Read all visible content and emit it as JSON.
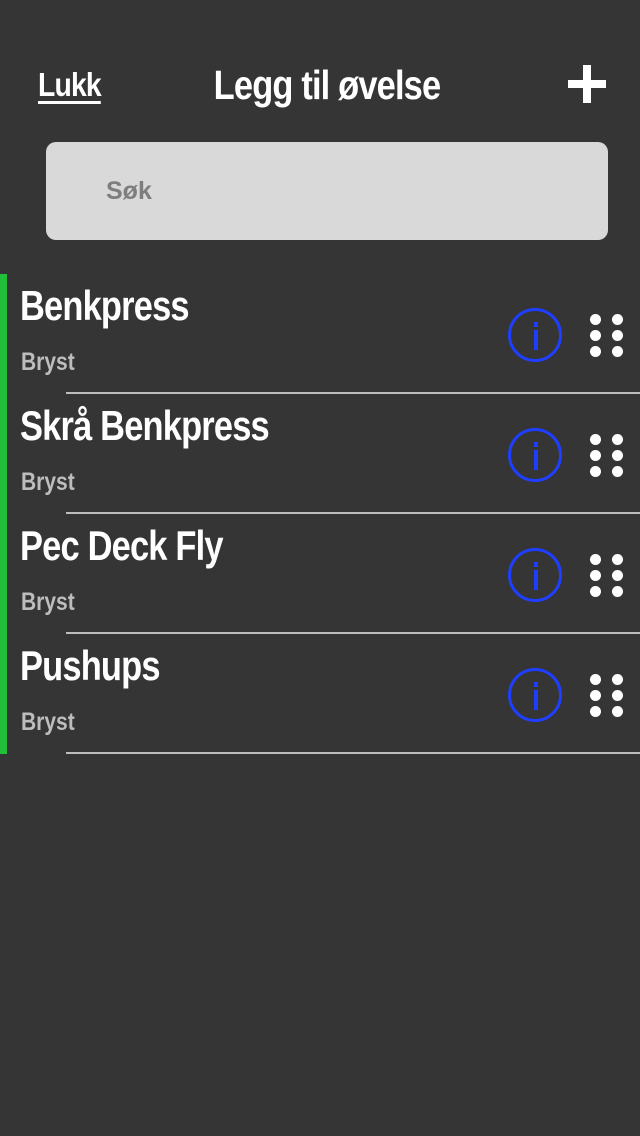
{
  "header": {
    "close_label": "Lukk",
    "title": "Legg til øvelse",
    "add_icon": "plus-icon"
  },
  "search": {
    "placeholder": "Søk",
    "value": ""
  },
  "exercises": [
    {
      "name": "Benkpress",
      "category": "Bryst"
    },
    {
      "name": "Skrå Benkpress",
      "category": "Bryst"
    },
    {
      "name": "Pec Deck Fly",
      "category": "Bryst"
    },
    {
      "name": "Pushups",
      "category": "Bryst"
    }
  ],
  "icons": {
    "info": "info-icon",
    "drag": "drag-handle-icon"
  },
  "colors": {
    "background": "#353535",
    "search_background": "#d9d9d9",
    "accent_selected": "#22c03a",
    "info_blue": "#1f3fff",
    "divider": "#bdbdbd",
    "category_text": "#bdbdbd"
  }
}
